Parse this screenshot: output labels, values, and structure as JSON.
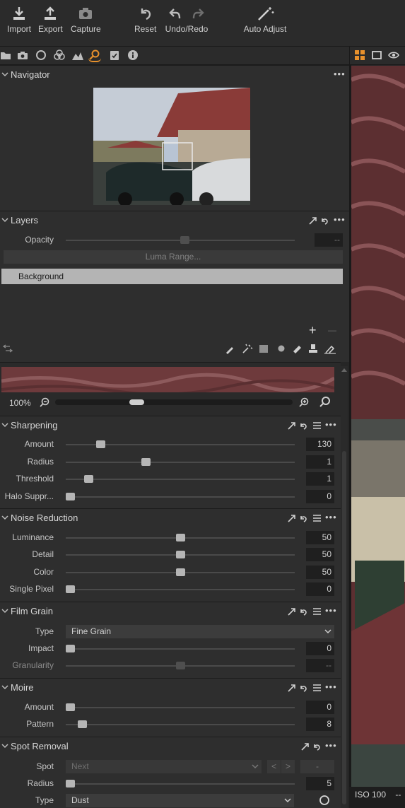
{
  "toolbar": {
    "import": "Import",
    "export": "Export",
    "capture": "Capture",
    "reset": "Reset",
    "undo_redo": "Undo/Redo",
    "auto_adjust": "Auto Adjust"
  },
  "navigator": {
    "title": "Navigator",
    "more": "•••"
  },
  "layers": {
    "title": "Layers",
    "more": "•••",
    "opacity_label": "Opacity",
    "opacity_value": "--",
    "luma_range_label": "Luma Range...",
    "layer_item": "Background",
    "add": "+",
    "remove": "—"
  },
  "detail_viewer": {
    "zoom": "100%"
  },
  "sharpening": {
    "title": "Sharpening",
    "more": "•••",
    "rows": [
      {
        "label": "Amount",
        "value": "130",
        "level": 0.15
      },
      {
        "label": "Radius",
        "value": "1",
        "level": 0.35
      },
      {
        "label": "Threshold",
        "value": "1",
        "level": 0.1
      },
      {
        "label": "Halo Suppr...",
        "value": "0",
        "level": 0.02
      }
    ]
  },
  "noise_reduction": {
    "title": "Noise Reduction",
    "more": "•••",
    "rows": [
      {
        "label": "Luminance",
        "value": "50",
        "level": 0.5
      },
      {
        "label": "Detail",
        "value": "50",
        "level": 0.5
      },
      {
        "label": "Color",
        "value": "50",
        "level": 0.5
      },
      {
        "label": "Single Pixel",
        "value": "0",
        "level": 0.02
      }
    ]
  },
  "film_grain": {
    "title": "Film Grain",
    "more": "•••",
    "type_label": "Type",
    "type_value": "Fine Grain",
    "rows": [
      {
        "label": "Impact",
        "value": "0",
        "level": 0.02
      },
      {
        "label": "Granularity",
        "value": "--",
        "level": 0.5,
        "disabled": true
      }
    ]
  },
  "moire": {
    "title": "Moire",
    "more": "•••",
    "rows": [
      {
        "label": "Amount",
        "value": "0",
        "level": 0.02
      },
      {
        "label": "Pattern",
        "value": "8",
        "level": 0.07
      }
    ]
  },
  "spot_removal": {
    "title": "Spot Removal",
    "more": "•••",
    "spot_label": "Spot",
    "spot_value": "Next",
    "prev": "<",
    "next": ">",
    "delete": "-",
    "radius_label": "Radius",
    "radius_value": "5",
    "radius_level": 0.02,
    "type_label": "Type",
    "type_value": "Dust"
  },
  "viewer": {
    "iso": "ISO 100",
    "extra": "--"
  },
  "colors": {
    "accent": "#e8912c",
    "panel": "#2e2e2e",
    "toolbar": "#2b2b2b"
  }
}
